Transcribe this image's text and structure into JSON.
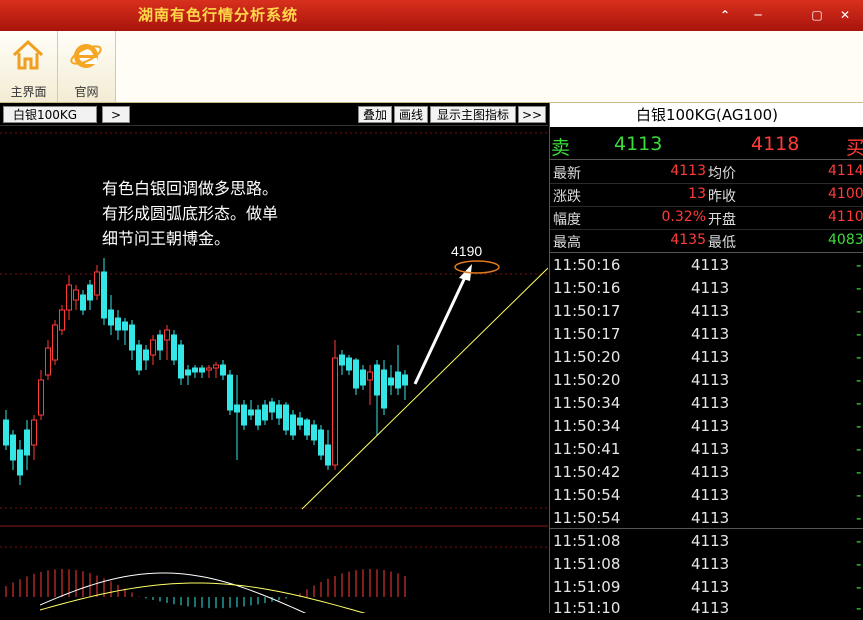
{
  "window": {
    "title": "湖南有色行情分析系统",
    "controls": [
      "⌃",
      "─",
      "▢",
      "✕"
    ]
  },
  "toolbar": {
    "home_label": "主界面",
    "site_label": "官网"
  },
  "chart_header": {
    "symbol": "白银100KG",
    "next_btn": ">",
    "overlay_btn": "叠加",
    "draw_btn": "画线",
    "indicator_btn": "显示主图指标",
    "more_btn": ">>"
  },
  "annotation": {
    "lines": [
      "有色白银回调做多思路。",
      "有形成圆弧底形态。做单",
      "细节问王朝博金。"
    ],
    "target": "4190"
  },
  "quote": {
    "title": "白银100KG(AG100)",
    "sell_label": "卖",
    "sell_price": "4113",
    "buy_price": "4118",
    "buy_label": "买",
    "rows": [
      {
        "l1": "最新",
        "v1": "4113",
        "l2": "均价",
        "v2": "4114"
      },
      {
        "l1": "涨跌",
        "v1": "13",
        "l2": "昨收",
        "v2": "4100"
      },
      {
        "l1": "幅度",
        "v1": "0.32%",
        "l2": "开盘",
        "v2": "4110"
      },
      {
        "l1": "最高",
        "v1": "4135",
        "l2": "最低",
        "v2": "4083"
      }
    ],
    "ticks": [
      {
        "t": "11:50:16",
        "p": "4113",
        "d": "-"
      },
      {
        "t": "11:50:16",
        "p": "4113",
        "d": "-"
      },
      {
        "t": "11:50:17",
        "p": "4113",
        "d": "-"
      },
      {
        "t": "11:50:17",
        "p": "4113",
        "d": "-"
      },
      {
        "t": "11:50:20",
        "p": "4113",
        "d": "-"
      },
      {
        "t": "11:50:20",
        "p": "4113",
        "d": "-"
      },
      {
        "t": "11:50:34",
        "p": "4113",
        "d": "-"
      },
      {
        "t": "11:50:34",
        "p": "4113",
        "d": "-"
      },
      {
        "t": "11:50:41",
        "p": "4113",
        "d": "-"
      },
      {
        "t": "11:50:42",
        "p": "4113",
        "d": "-"
      },
      {
        "t": "11:50:54",
        "p": "4113",
        "d": "-"
      },
      {
        "t": "11:50:54",
        "p": "4113",
        "d": "-"
      },
      {
        "t": "11:51:08",
        "p": "4113",
        "d": "-"
      },
      {
        "t": "11:51:08",
        "p": "4113",
        "d": "-"
      },
      {
        "t": "11:51:09",
        "p": "4113",
        "d": "-"
      },
      {
        "t": "11:51:10",
        "p": "4113",
        "d": "-"
      }
    ]
  },
  "colors": {
    "up": "#ff3b3b",
    "down": "#35e6e6",
    "sell": "#3cdc3c",
    "buy": "#ff3b3b",
    "trend": "#ffff66",
    "arrow": "#ffffff",
    "ellipse": "#e07a1e"
  }
}
